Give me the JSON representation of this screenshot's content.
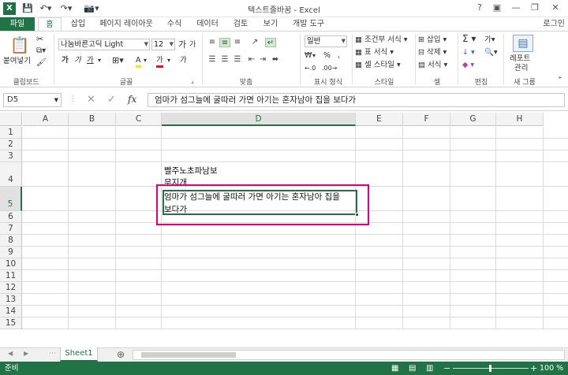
{
  "titlebar": {
    "app_icon": "X",
    "title": "텍스트줄바꿈 - Excel",
    "qat": [
      "save-icon",
      "undo-icon",
      "redo-icon",
      "camera-icon"
    ],
    "controls": [
      "?",
      "▣",
      "—",
      "❐",
      "✕"
    ]
  },
  "tabs": {
    "file": "파일",
    "items": [
      "홈",
      "삽입",
      "페이지 레이아웃",
      "수식",
      "데이터",
      "검토",
      "보기",
      "개발 도구"
    ],
    "login": "로그인"
  },
  "ribbon": {
    "clipboard": {
      "paste_label": "붙여넣기",
      "group": "클립보드"
    },
    "font": {
      "name": "나눔바른고딕 Light",
      "size": "12",
      "grow": "가",
      "shrink": "가",
      "bold": "가",
      "italic": "가",
      "underline": "가",
      "fill": "A",
      "color": "가",
      "extra": "가",
      "group": "글꼴"
    },
    "alignment": {
      "group": "맞춤"
    },
    "number": {
      "format": "일반",
      "currency": "₩",
      "percent": "%",
      "comma": ",",
      "group": "표시 형식"
    },
    "styles": {
      "conditional": "조건부 서식",
      "table": "표 서식",
      "cell": "셀 스타일",
      "group": "스타일"
    },
    "cells": {
      "insert": "삽입",
      "delete": "삭제",
      "format": "서식",
      "group": "셀"
    },
    "editing": {
      "sum": "Σ",
      "fill": "↓",
      "clear": "◆",
      "sort": "가",
      "find": "🔍",
      "group": "편집"
    },
    "new_group": {
      "report": "레포트",
      "manage": "관리",
      "group": "새 그룹"
    }
  },
  "formula_bar": {
    "name_box": "D5",
    "cancel": "✕",
    "enter": "✓",
    "fx": "fx",
    "content": "엄마가 섬그늘에 굴따러 가면 아기는 혼자남아 집을 보다가"
  },
  "grid": {
    "columns": [
      "A",
      "B",
      "C",
      "D",
      "E",
      "F",
      "G",
      "H"
    ],
    "rows": [
      "1",
      "2",
      "3",
      "4",
      "5",
      "6",
      "7",
      "8",
      "9",
      "10",
      "11",
      "12",
      "13",
      "14",
      "15"
    ],
    "active_cell": "D5",
    "cells": {
      "d4_line1": "빨주노초파남보",
      "d4_line2": "무지개",
      "d5_line1": "엄마가 섬그늘에 굴따러 가면 아기는 혼자남아 집을",
      "d5_line2": "보다가"
    },
    "highlight_color": "#e0007a"
  },
  "sheets": {
    "tabs": [
      "Sheet1"
    ],
    "add": "⊕"
  },
  "status": {
    "ready": "준비",
    "zoom": "100 %"
  },
  "colors": {
    "accent": "#217346"
  }
}
